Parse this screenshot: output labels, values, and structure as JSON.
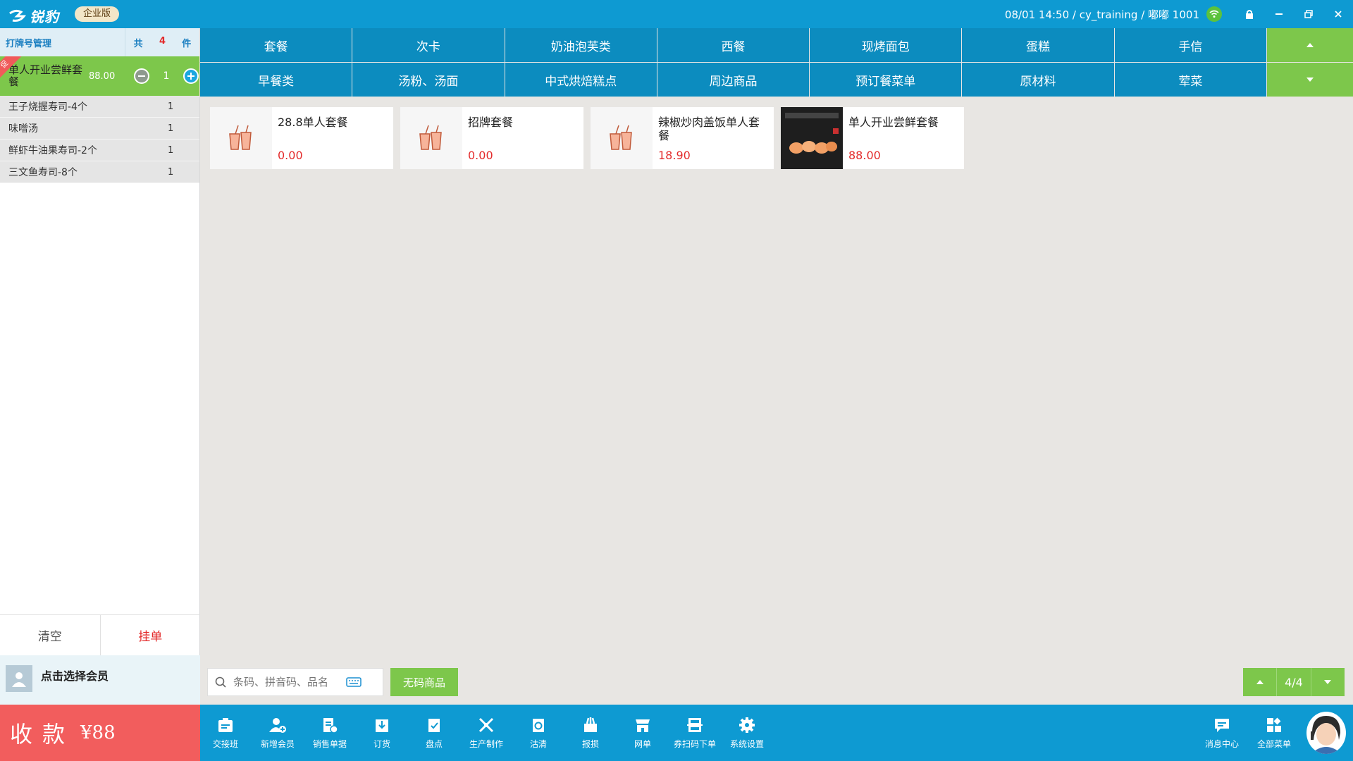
{
  "topbar": {
    "logo_text": "锐豹",
    "edition": "企业版",
    "info": "08/01 14:50 / cy_training / 嘟嘟 1001"
  },
  "order": {
    "title": "打牌号管理",
    "count_prefix": "共",
    "count": "4",
    "count_suffix": "件",
    "main_item": {
      "badge": "促",
      "name": "单人开业尝鲜套餐",
      "price": "88.00",
      "qty": "1"
    },
    "sub_items": [
      {
        "name": "王子烧握寿司-4个",
        "qty": "1"
      },
      {
        "name": "味噌汤",
        "qty": "1"
      },
      {
        "name": "鲜虾牛油果寿司-2个",
        "qty": "1"
      },
      {
        "name": "三文鱼寿司-8个",
        "qty": "1"
      }
    ],
    "clear_label": "清空",
    "hold_label": "挂单",
    "member_label": "点击选择会员",
    "pay_label": "收款",
    "pay_amount": "¥88"
  },
  "categories": {
    "row1": [
      "套餐",
      "次卡",
      "奶油泡芙类",
      "西餐",
      "现烤面包",
      "蛋糕",
      "手信"
    ],
    "row2": [
      "早餐类",
      "汤粉、汤面",
      "中式烘焙糕点",
      "周边商品",
      "预订餐菜单",
      "原材料",
      "荤菜"
    ]
  },
  "products": [
    {
      "name": "28.8单人套餐",
      "price": "0.00",
      "image": "drink-icon"
    },
    {
      "name": "招牌套餐",
      "price": "0.00",
      "image": "drink-icon"
    },
    {
      "name": "辣椒炒肉盖饭单人套餐",
      "price": "18.90",
      "image": "drink-icon"
    },
    {
      "name": "单人开业尝鲜套餐",
      "price": "88.00",
      "image": "sushi-photo"
    }
  ],
  "search": {
    "placeholder": "条码、拼音码、品名"
  },
  "nocode_label": "无码商品",
  "pager": {
    "page": "4/4"
  },
  "toolbar": {
    "tools": [
      "交接班",
      "新增会员",
      "销售单据",
      "订货",
      "盘点",
      "生产制作",
      "沽清",
      "报损",
      "网单",
      "券扫码下单",
      "系统设置"
    ],
    "right_tools": [
      "消息中心",
      "全部菜单"
    ]
  },
  "colors": {
    "primary": "#0e9ad2",
    "accent_green": "#7dc74b",
    "pay_red": "#f25d5d",
    "price_red": "#e32b2b"
  }
}
